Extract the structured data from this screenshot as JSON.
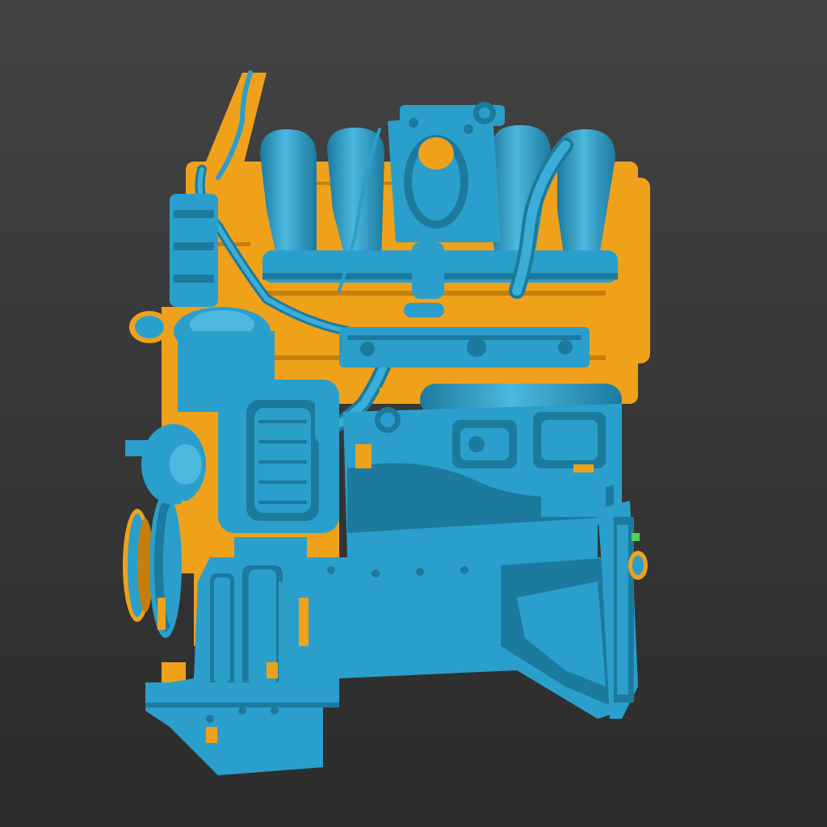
{
  "viewer": {
    "background_top": "#434343",
    "background_bottom": "#2c2c2c"
  },
  "model": {
    "subject": "engine-3d-scan",
    "colors": {
      "mesh": "#2b9fcb",
      "mesh_dark": "#1c7a9e",
      "mesh_light": "#4cb7df",
      "deviation": "#f0a11a",
      "deviation_dark": "#c47f0c"
    }
  }
}
